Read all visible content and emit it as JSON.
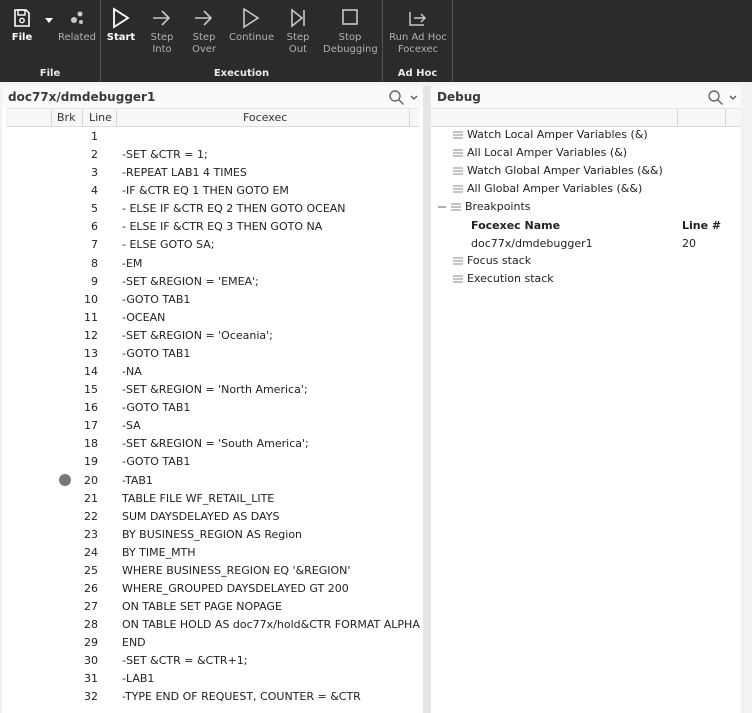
{
  "ribbon": {
    "file_group": {
      "label": "File",
      "file_button": "File",
      "related_button": "Related"
    },
    "execution_group": {
      "label": "Execution",
      "start": "Start",
      "step_into": [
        "Step",
        "Into"
      ],
      "step_over": [
        "Step",
        "Over"
      ],
      "continue": "Continue",
      "step_out": [
        "Step",
        "Out"
      ],
      "stop_debugging": [
        "Stop",
        "Debugging"
      ]
    },
    "adhoc_group": {
      "label": "Ad Hoc",
      "run_adhoc": [
        "Run Ad Hoc",
        "Focexec"
      ]
    }
  },
  "editor": {
    "title": "doc77x/dmdebugger1",
    "columns": {
      "brk": "Brk",
      "line": "Line",
      "focexec": "Focexec"
    },
    "breakpoint_lines": [
      20
    ],
    "lines": [
      {
        "n": "1",
        "text": ""
      },
      {
        "n": "2",
        "text": "-SET &CTR = 1;"
      },
      {
        "n": "3",
        "text": "-REPEAT LAB1 4 TIMES"
      },
      {
        "n": "4",
        "text": "-IF &CTR EQ 1 THEN GOTO EM"
      },
      {
        "n": "5",
        "text": "- ELSE IF &CTR EQ 2 THEN GOTO OCEAN"
      },
      {
        "n": "6",
        "text": "- ELSE IF &CTR EQ 3 THEN GOTO NA"
      },
      {
        "n": "7",
        "text": "- ELSE GOTO SA;"
      },
      {
        "n": "8",
        "text": "-EM"
      },
      {
        "n": "9",
        "text": "-SET &REGION = 'EMEA';"
      },
      {
        "n": "10",
        "text": "-GOTO TAB1"
      },
      {
        "n": "11",
        "text": "-OCEAN"
      },
      {
        "n": "12",
        "text": "-SET &REGION = 'Oceania';"
      },
      {
        "n": "13",
        "text": "-GOTO TAB1"
      },
      {
        "n": "14",
        "text": "-NA"
      },
      {
        "n": "15",
        "text": "-SET &REGION = 'North America';"
      },
      {
        "n": "16",
        "text": "-GOTO TAB1"
      },
      {
        "n": "17",
        "text": "-SA"
      },
      {
        "n": "18",
        "text": "-SET &REGION = 'South America';"
      },
      {
        "n": "19",
        "text": "-GOTO TAB1"
      },
      {
        "n": "20",
        "text": "-TAB1"
      },
      {
        "n": "21",
        "text": "TABLE FILE WF_RETAIL_LITE"
      },
      {
        "n": "22",
        "text": "SUM DAYSDELAYED AS DAYS"
      },
      {
        "n": "23",
        "text": "BY BUSINESS_REGION AS Region"
      },
      {
        "n": "24",
        "text": "BY TIME_MTH"
      },
      {
        "n": "25",
        "text": "WHERE BUSINESS_REGION EQ '&REGION'"
      },
      {
        "n": "26",
        "text": "WHERE_GROUPED DAYSDELAYED GT 200"
      },
      {
        "n": "27",
        "text": "ON TABLE SET PAGE NOPAGE"
      },
      {
        "n": "28",
        "text": "ON TABLE HOLD AS doc77x/hold&CTR FORMAT ALPHA"
      },
      {
        "n": "29",
        "text": "END"
      },
      {
        "n": "30",
        "text": "-SET &CTR = &CTR+1;"
      },
      {
        "n": "31",
        "text": "-LAB1"
      },
      {
        "n": "32",
        "text": "-TYPE END OF REQUEST, COUNTER = &CTR"
      }
    ]
  },
  "debug": {
    "title": "Debug",
    "items": {
      "watch_local": "Watch Local Amper Variables (&)",
      "all_local": "All Local Amper Variables (&)",
      "watch_global": "Watch Global Amper Variables (&&)",
      "all_global": "All Global Amper Variables (&&)",
      "breakpoints": "Breakpoints",
      "focus_stack": "Focus stack",
      "execution_stack": "Execution stack"
    },
    "breakpoints_table": {
      "col_name": "Focexec Name",
      "col_line": "Line #",
      "rows": [
        {
          "name": "doc77x/dmdebugger1",
          "line": "20"
        }
      ]
    }
  },
  "colors": {
    "ribbon_bg": "#2b2b2b",
    "breakpoint": "#777777"
  }
}
